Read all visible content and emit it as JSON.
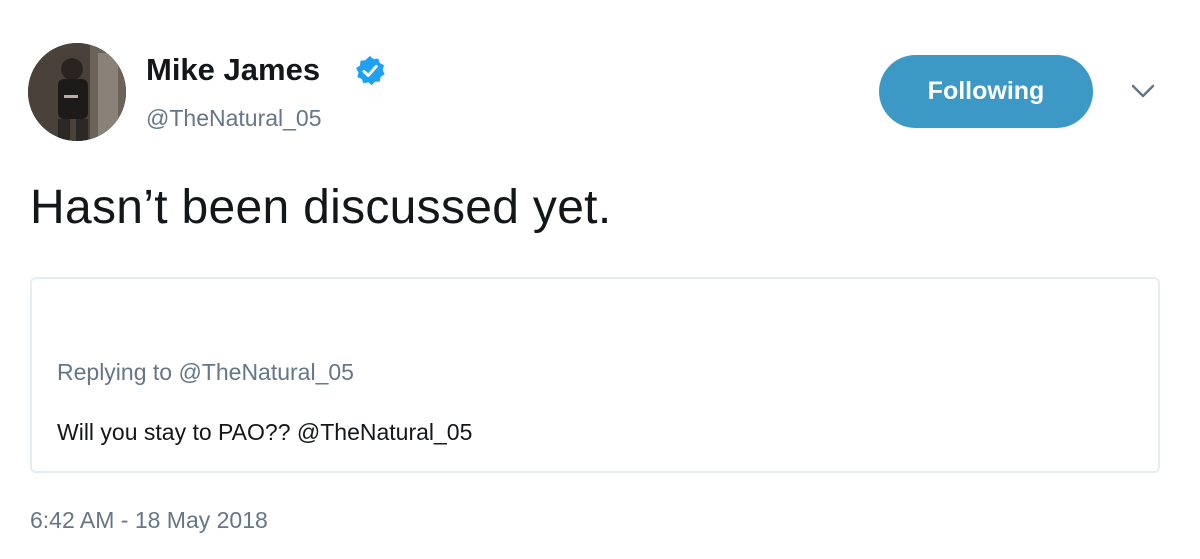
{
  "author": {
    "display_name": "Mike James",
    "handle": "@TheNatural_05",
    "verified": true
  },
  "follow_button": {
    "label": "Following"
  },
  "tweet": {
    "text": "Hasn’t been discussed yet.",
    "timestamp": "6:42 AM - 18 May 2018"
  },
  "quoted": {
    "replying_to": "Replying to @TheNatural_05",
    "text": "Will you stay to PAO?? @TheNatural_05"
  },
  "colors": {
    "accent": "#3c99c6",
    "verified_badge": "#1da1f2",
    "secondary_text": "#657786",
    "border": "#e6ecf0"
  },
  "icons": [
    "avatar",
    "verified-badge-icon",
    "chevron-down-icon"
  ]
}
